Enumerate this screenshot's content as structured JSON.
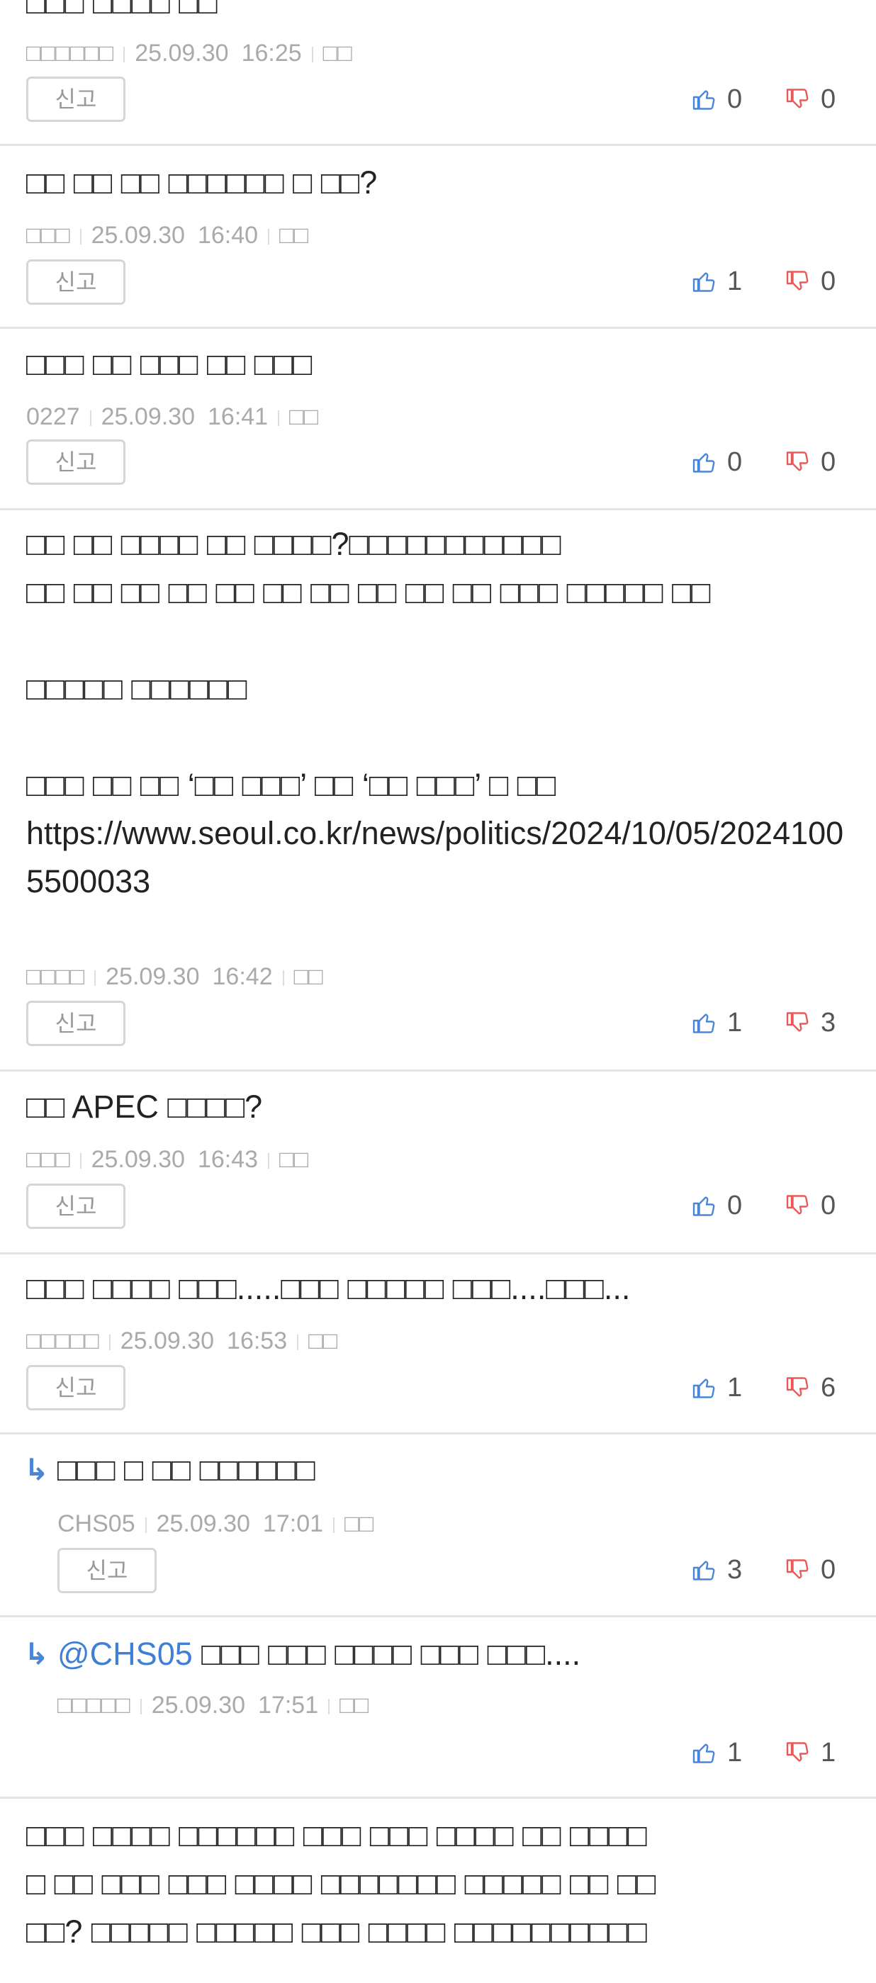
{
  "labels": {
    "report": "신고",
    "separator_meta": "삭제"
  },
  "colors": {
    "up": "#4a86d8",
    "down": "#e85a5a",
    "mention": "#3f7fd6"
  },
  "comments": [
    {
      "text": "□□□ □□□□ □□",
      "author": "□□□□□□",
      "date": "25.09.30",
      "time": "16:25",
      "action": "□□",
      "up": "0",
      "down": "0"
    },
    {
      "text": "□□ □□ □□ □□□□□□ □ □□?",
      "author": "□□□",
      "date": "25.09.30",
      "time": "16:40",
      "action": "□□",
      "up": "1",
      "down": "0"
    },
    {
      "text": "□□□ □□ □□□ □□ □□□",
      "author": "0227",
      "date": "25.09.30",
      "time": "16:41",
      "action": "□□",
      "up": "0",
      "down": "0"
    },
    {
      "text": "□□ □□ □□□□ □□ □□□□?□□□□□□□□□□□\n□□ □□ □□ □□ □□ □□ □□ □□ □□ □□ □□□ □□□□□ □□\n\n□□□□□ □□□□□□\n\n□□□ □□ □□ ‘□□ □□□’ □□ ‘□□ □□□’ □ □□\nhttps://www.seoul.co.kr/news/politics/2024/10/05/20241005500033",
      "author": "□□□□",
      "date": "25.09.30",
      "time": "16:42",
      "action": "□□",
      "up": "1",
      "down": "3"
    },
    {
      "text": "□□ APEC □□□□?",
      "author": "□□□",
      "date": "25.09.30",
      "time": "16:43",
      "action": "□□",
      "up": "0",
      "down": "0"
    },
    {
      "text": "□□□ □□□□ □□□.....□□□ □□□□□ □□□....□□□...",
      "author": "□□□□□",
      "date": "25.09.30",
      "time": "16:53",
      "action": "□□",
      "up": "1",
      "down": "6"
    },
    {
      "reply": true,
      "mention": "",
      "text": "□□□ □ □□ □□□□□□",
      "author": "CHS05",
      "date": "25.09.30",
      "time": "17:01",
      "action": "□□",
      "up": "3",
      "down": "0"
    },
    {
      "reply": true,
      "mention": "@CHS05",
      "text": "□□□ □□□ □□□□ □□□ □□□....",
      "author": "□□□□□",
      "date": "25.09.30",
      "time": "17:51",
      "action": "□□",
      "up": "1",
      "down": "1"
    },
    {
      "text": "□□□ □□□□ □□□□□□ □□□ □□□ □□□□ □□ □□□□\n□ □□ □□□ □□□ □□□□ □□□□□□□ □□□□□ □□ □□\n□□? □□□□□ □□□□□ □□□ □□□□ □□□□□□□□□□",
      "author": "",
      "date": "",
      "time": "",
      "action": "",
      "up": "",
      "down": ""
    }
  ]
}
